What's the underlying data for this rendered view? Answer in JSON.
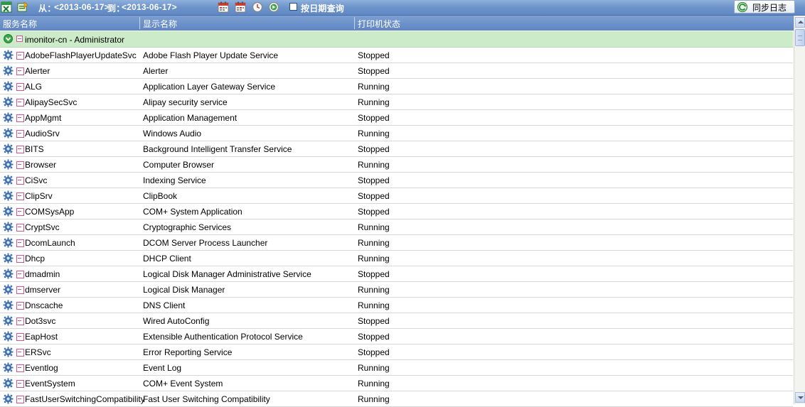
{
  "toolbar": {
    "from_label": "从：",
    "from_date": "<2013-06-17>",
    "to_label": "到：",
    "to_date": "<2013-06-17>",
    "query_by_date_label": "按日期查询",
    "sync_log_label": "同步日志",
    "icons": [
      "excel-export-icon",
      "export-icon",
      "calendar-from-icon",
      "calendar-to-icon",
      "clock-icon",
      "refresh-go-icon",
      "sync-icon"
    ]
  },
  "columns": {
    "service_name": "服务名称",
    "display_name": "显示名称",
    "printer_status": "打印机状态"
  },
  "group": {
    "label": "imonitor-cn - Administrator"
  },
  "rows": [
    {
      "name": "AdobeFlashPlayerUpdateSvc",
      "display": "Adobe Flash Player Update Service",
      "status": "Stopped"
    },
    {
      "name": "Alerter",
      "display": "Alerter",
      "status": "Stopped"
    },
    {
      "name": "ALG",
      "display": "Application Layer Gateway Service",
      "status": "Running"
    },
    {
      "name": "AlipaySecSvc",
      "display": "Alipay security service",
      "status": "Running"
    },
    {
      "name": "AppMgmt",
      "display": "Application Management",
      "status": "Stopped"
    },
    {
      "name": "AudioSrv",
      "display": "Windows Audio",
      "status": "Running"
    },
    {
      "name": "BITS",
      "display": "Background Intelligent Transfer Service",
      "status": "Stopped"
    },
    {
      "name": "Browser",
      "display": "Computer Browser",
      "status": "Running"
    },
    {
      "name": "CiSvc",
      "display": "Indexing Service",
      "status": "Stopped"
    },
    {
      "name": "ClipSrv",
      "display": "ClipBook",
      "status": "Stopped"
    },
    {
      "name": "COMSysApp",
      "display": "COM+ System Application",
      "status": "Stopped"
    },
    {
      "name": "CryptSvc",
      "display": "Cryptographic Services",
      "status": "Running"
    },
    {
      "name": "DcomLaunch",
      "display": "DCOM Server Process Launcher",
      "status": "Running"
    },
    {
      "name": "Dhcp",
      "display": "DHCP Client",
      "status": "Running"
    },
    {
      "name": "dmadmin",
      "display": "Logical Disk Manager Administrative Service",
      "status": "Stopped"
    },
    {
      "name": "dmserver",
      "display": "Logical Disk Manager",
      "status": "Running"
    },
    {
      "name": "Dnscache",
      "display": "DNS Client",
      "status": "Running"
    },
    {
      "name": "Dot3svc",
      "display": "Wired AutoConfig",
      "status": "Stopped"
    },
    {
      "name": "EapHost",
      "display": "Extensible Authentication Protocol Service",
      "status": "Stopped"
    },
    {
      "name": "ERSvc",
      "display": "Error Reporting Service",
      "status": "Stopped"
    },
    {
      "name": "Eventlog",
      "display": "Event Log",
      "status": "Running"
    },
    {
      "name": "EventSystem",
      "display": "COM+ Event System",
      "status": "Running"
    },
    {
      "name": "FastUserSwitchingCompatibility",
      "display": "Fast User Switching Compatibility",
      "status": "Running"
    }
  ]
}
